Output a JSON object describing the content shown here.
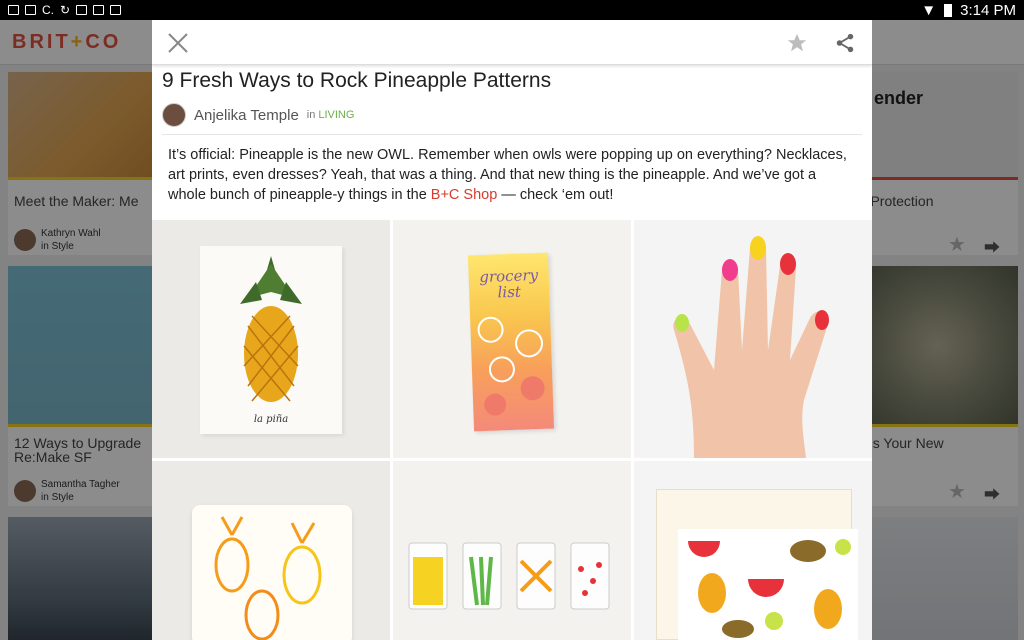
{
  "status_bar": {
    "time": "3:14 PM",
    "left_text": "C."
  },
  "app": {
    "logo_left": "BRIT",
    "logo_plus": "+",
    "logo_right": "CO",
    "cards": [
      {
        "title": "Meet the Maker: Me",
        "author": "Kathryn Wahl",
        "category": "Style",
        "in": "in"
      },
      {
        "title": "12 Ways to Upgrade\nRe:Make SF",
        "author": "Samantha Tagher",
        "category": "Style",
        "in": "in"
      },
      {
        "title": "rt Protection"
      },
      {
        "title": "g is Your New"
      },
      {
        "title": "ender"
      }
    ]
  },
  "article": {
    "title": "9 Fresh Ways to Rock Pineapple Patterns",
    "author": "Anjelika Temple",
    "in": "in",
    "category": "LIVING",
    "body_1": "It’s official: Pineapple is the new OWL. Remember when owls were popping up on everything? Necklaces, art prints, even dresses? Yeah, that was a thing. And that new thing is the pineapple. And we’ve got a whole bunch of pineapple-y things in the ",
    "body_link": "B+C Shop",
    "body_2": " — check ‘em out!",
    "print_caption": "la piña",
    "notepad_text": "grocery list"
  },
  "colors": {
    "brand": "#e0533f",
    "accent_link": "#d93a2c",
    "category": "#6ab04c"
  }
}
